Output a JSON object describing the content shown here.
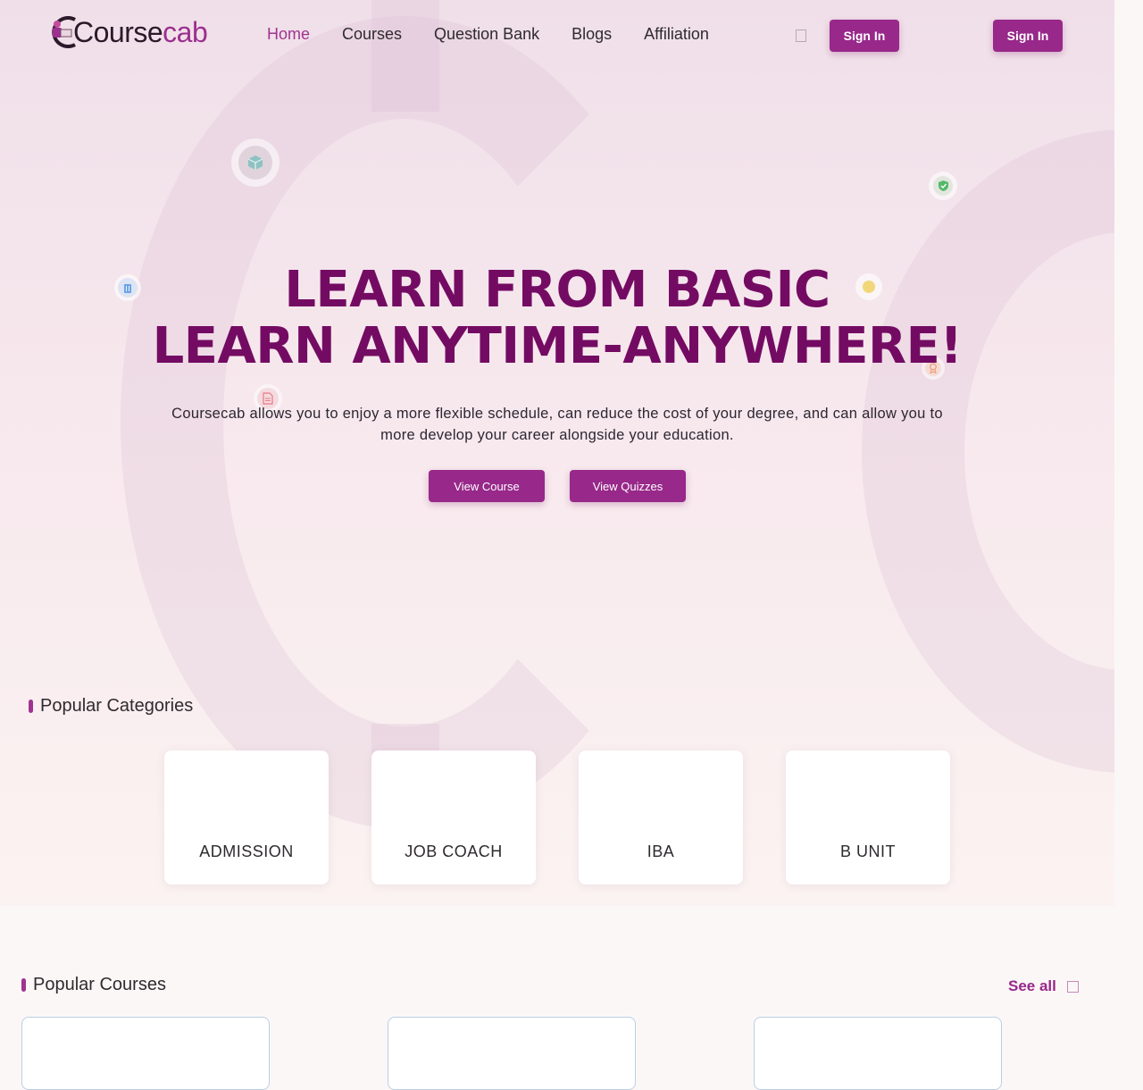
{
  "brand": {
    "logo_part1": "C",
    "logo_part2": "ourse",
    "logo_part3": "cab"
  },
  "nav": {
    "items": [
      {
        "label": "Home",
        "active": true
      },
      {
        "label": "Courses"
      },
      {
        "label": "Question Bank"
      },
      {
        "label": "Blogs"
      },
      {
        "label": "Affiliation"
      }
    ]
  },
  "header": {
    "signin_primary": "Sign In",
    "signin_secondary": "Sign In"
  },
  "hero": {
    "line1": "LEARN FROM BASIC",
    "line2": "LEARN ANYTIME-ANYWHERE!",
    "description": "Coursecab allows you to enjoy a more flexible schedule, can reduce the cost of your degree, and can allow you to more develop your career alongside your education.",
    "view_course": "View Course",
    "view_quizzes": "View Quizzes"
  },
  "categories": {
    "title": "Popular Categories",
    "items": [
      "ADMISSION",
      "JOB COACH",
      "IBA",
      "B UNIT"
    ]
  },
  "courses": {
    "title": "Popular Courses",
    "see_all": "See all"
  },
  "colors": {
    "accent": "#98288a",
    "headline": "#740b63",
    "active_nav": "#a0338f"
  },
  "icons": [
    "box-icon",
    "shield-check-icon",
    "trash-icon",
    "circle-dot-icon",
    "award-icon",
    "document-icon"
  ]
}
